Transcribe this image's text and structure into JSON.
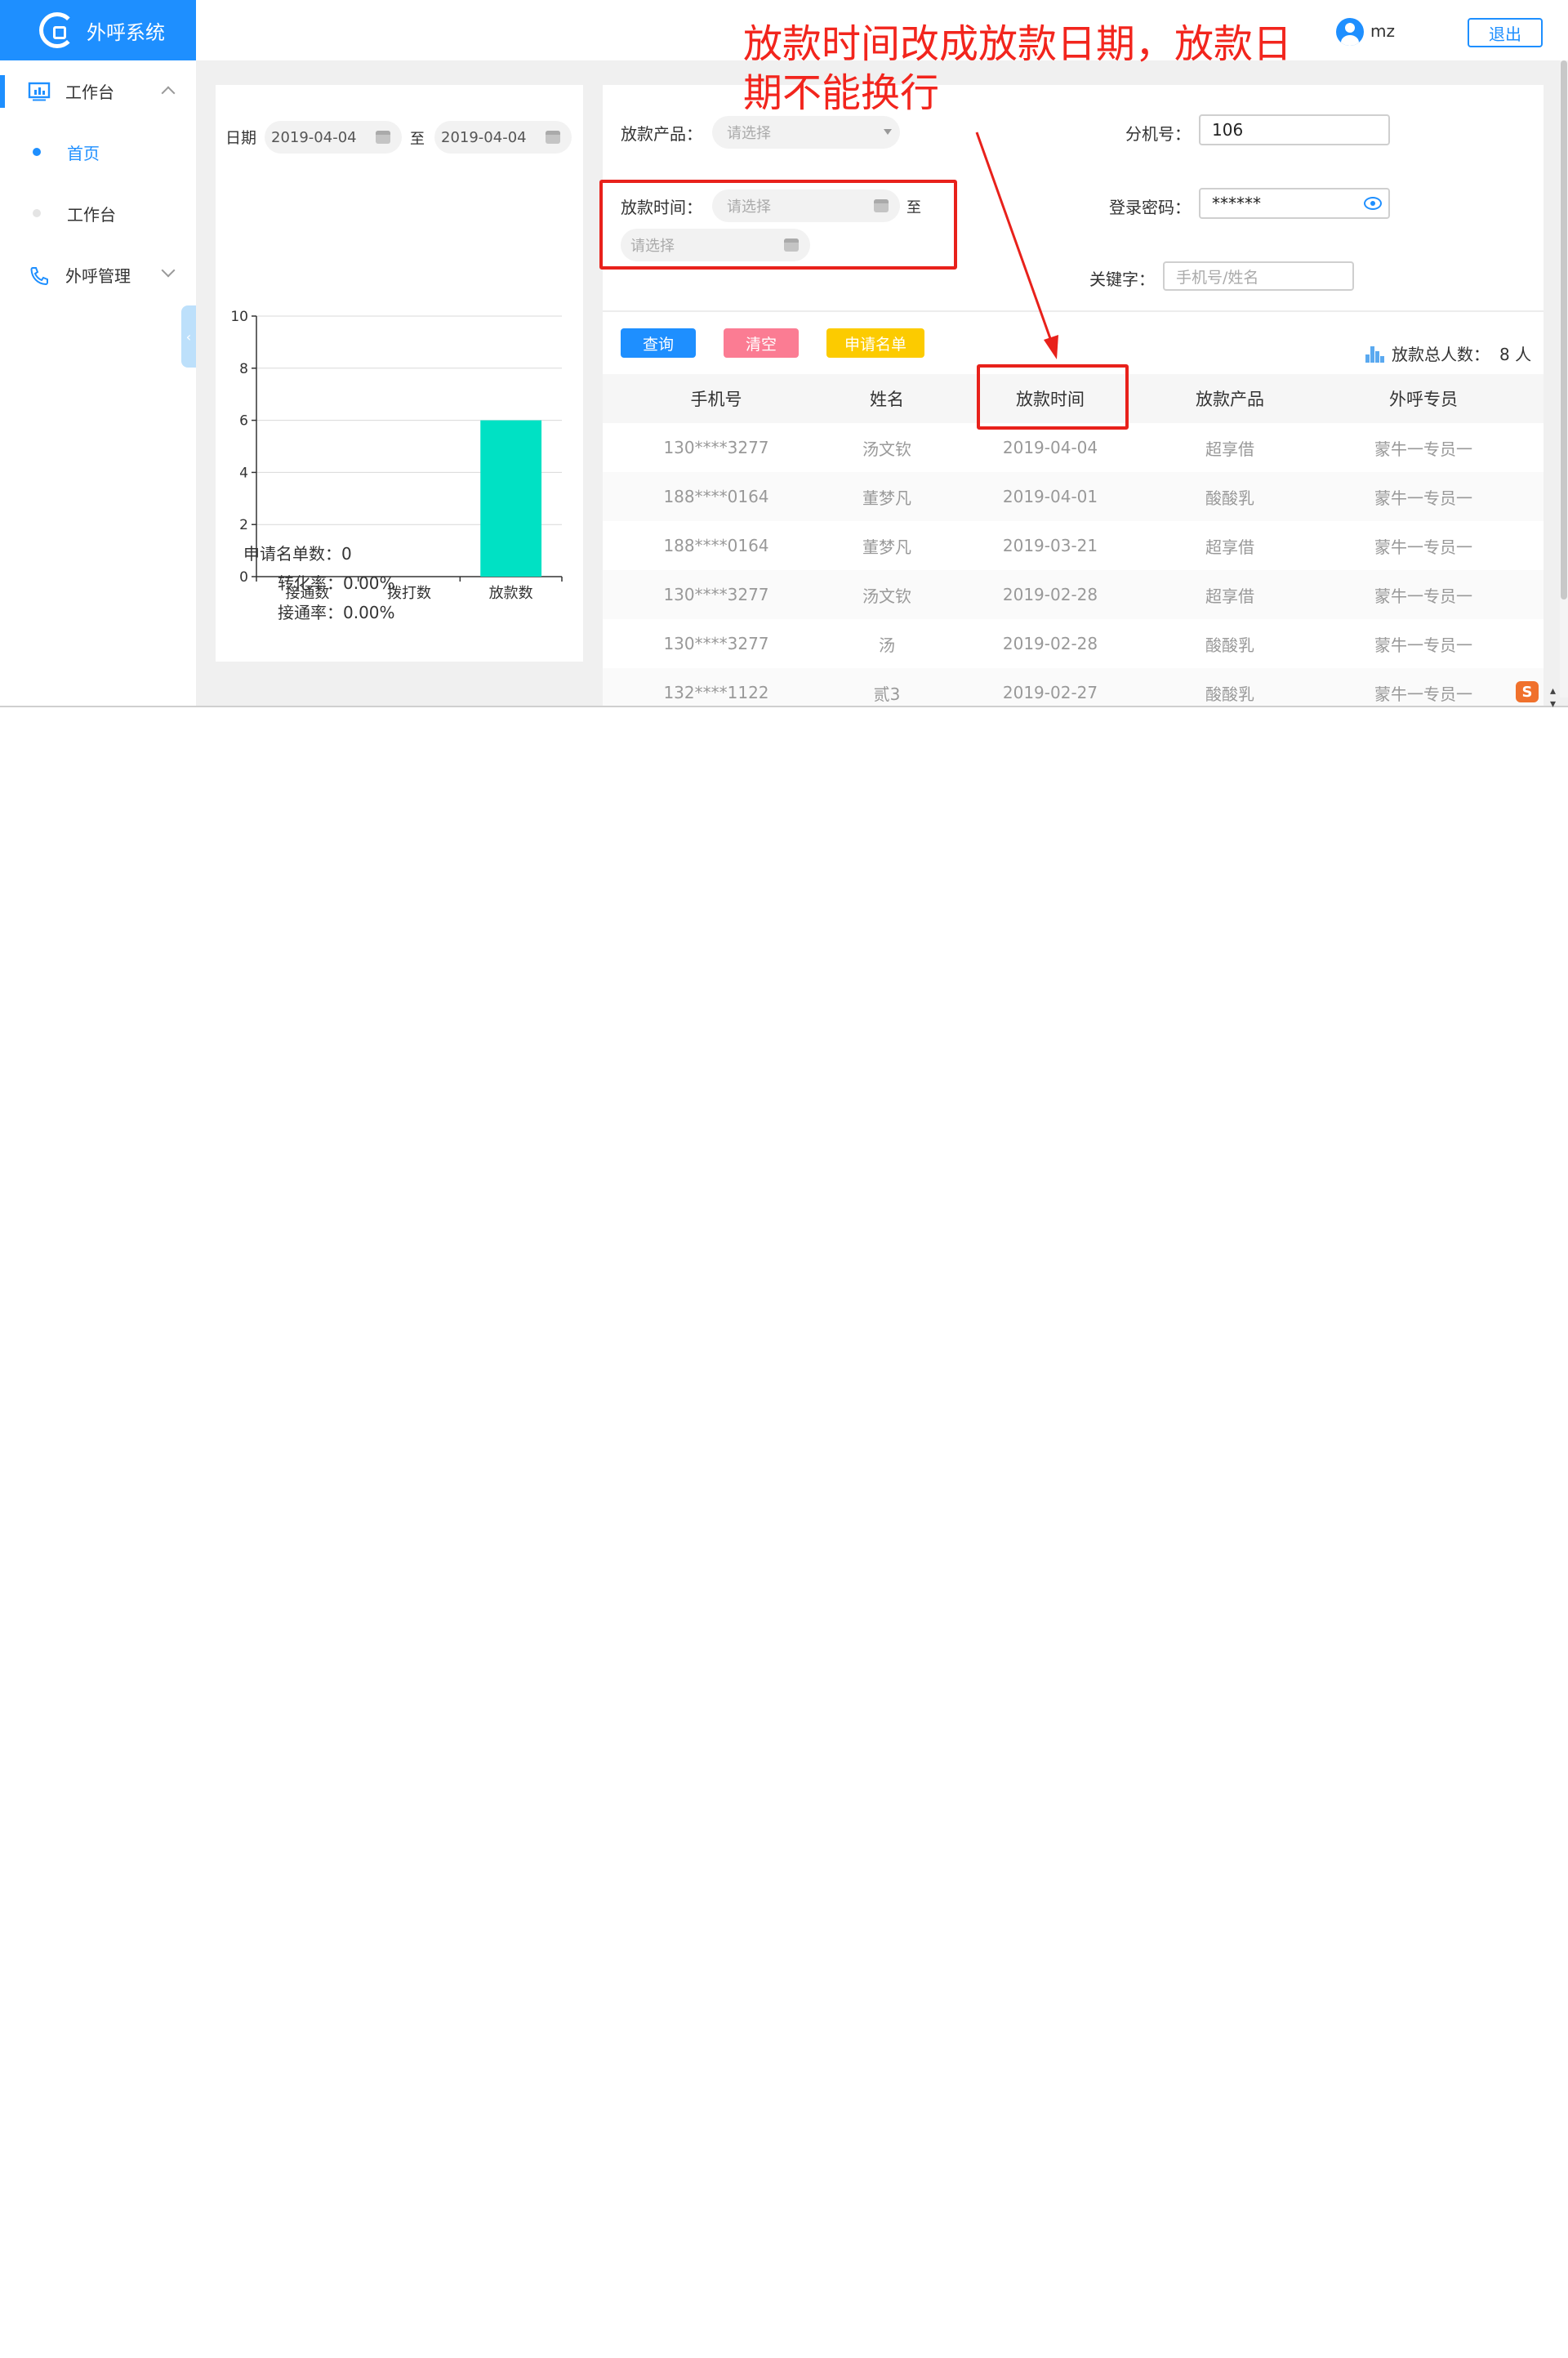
{
  "app": {
    "title": "外呼系统"
  },
  "sidebar": {
    "groups": [
      {
        "label": "工作台",
        "items": [
          {
            "label": "首页"
          },
          {
            "label": "工作台"
          }
        ]
      },
      {
        "label": "外呼管理"
      }
    ]
  },
  "header": {
    "user": "mz",
    "logout": "退出"
  },
  "left": {
    "date_label": "日期",
    "date_from": "2019-04-04",
    "date_sep": "至",
    "date_to": "2019-04-04",
    "stats": [
      {
        "label": "申请名单数：",
        "value": "0"
      },
      {
        "label": "转化率：",
        "value": "0.00%"
      },
      {
        "label": "接通率：",
        "value": "0.00%"
      }
    ]
  },
  "chart_data": {
    "type": "bar",
    "categories": [
      "接通数",
      "拨打数",
      "放款数"
    ],
    "values": [
      0,
      0,
      6
    ],
    "ylim": [
      0,
      10
    ],
    "yticks": [
      0,
      2,
      4,
      6,
      8,
      10
    ],
    "grid": true,
    "color": "#00e1c4"
  },
  "filters": {
    "product_label": "放款产品：",
    "product_placeholder": "请选择",
    "time_label": "放款时间：",
    "time_from_placeholder": "请选择",
    "time_sep": "至",
    "time_to_placeholder": "请选择",
    "ext_label": "分机号：",
    "ext_value": "106",
    "pwd_label": "登录密码：",
    "pwd_value": "******",
    "keyword_label": "关键字：",
    "keyword_placeholder": "手机号/姓名"
  },
  "actions": {
    "query": "查询",
    "clear": "清空",
    "apply": "申请名单",
    "total_label": "放款总人数：",
    "total_value": "8 人"
  },
  "table": {
    "headers": [
      "手机号",
      "姓名",
      "放款时间",
      "放款产品",
      "外呼专员"
    ],
    "rows": [
      [
        "130****3277",
        "汤文钦",
        "2019-04-04",
        "超享借",
        "蒙牛一专员一"
      ],
      [
        "188****0164",
        "董梦凡",
        "2019-04-01",
        "酸酸乳",
        "蒙牛一专员一"
      ],
      [
        "188****0164",
        "董梦凡",
        "2019-03-21",
        "超享借",
        "蒙牛一专员一"
      ],
      [
        "130****3277",
        "汤文钦",
        "2019-02-28",
        "超享借",
        "蒙牛一专员一"
      ],
      [
        "130****3277",
        "汤",
        "2019-02-28",
        "酸酸乳",
        "蒙牛一专员一"
      ],
      [
        "132****1122",
        "贰3",
        "2019-02-27",
        "酸酸乳",
        "蒙牛一专员一"
      ]
    ]
  },
  "annotation": {
    "text": "放款时间改成放款日期，放款日期不能换行",
    "color": "#e8211b"
  },
  "colors": {
    "primary": "#1e8fff",
    "query_btn": "#1e8fff",
    "clear_btn": "#fb7c93",
    "apply_btn": "#fccb00"
  },
  "corner_badge": "S"
}
